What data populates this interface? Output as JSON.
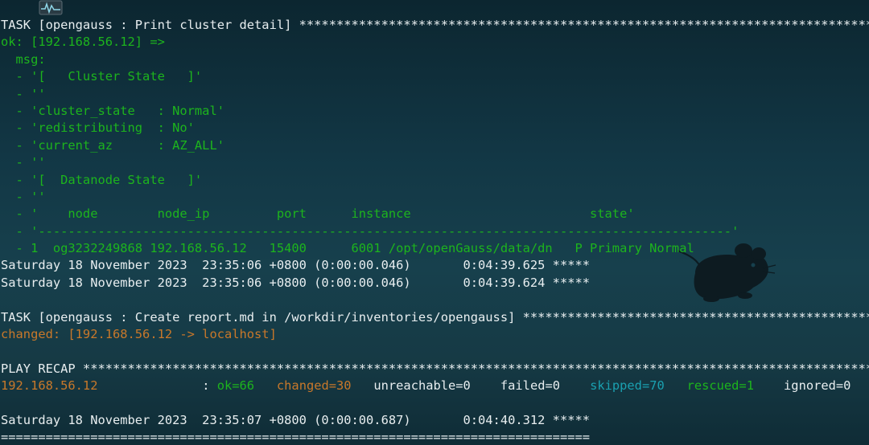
{
  "lines": [
    [
      {
        "t": "TASK [opengauss : Print cluster detail] **************************************************************************************************************",
        "c": "w"
      }
    ],
    [
      {
        "t": "ok: [192.168.56.12] =>",
        "c": "g"
      }
    ],
    [
      {
        "t": "  msg:",
        "c": "g"
      }
    ],
    [
      {
        "t": "  - '[   Cluster State   ]'",
        "c": "g"
      }
    ],
    [
      {
        "t": "  - ''",
        "c": "g"
      }
    ],
    [
      {
        "t": "  - 'cluster_state   : Normal'",
        "c": "g"
      }
    ],
    [
      {
        "t": "  - 'redistributing  : No'",
        "c": "g"
      }
    ],
    [
      {
        "t": "  - 'current_az      : AZ_ALL'",
        "c": "g"
      }
    ],
    [
      {
        "t": "  - ''",
        "c": "g"
      }
    ],
    [
      {
        "t": "  - '[  Datanode State   ]'",
        "c": "g"
      }
    ],
    [
      {
        "t": "  - ''",
        "c": "g"
      }
    ],
    [
      {
        "t": "  - '    node        node_ip         port      instance                        state'",
        "c": "g"
      }
    ],
    [
      {
        "t": "  - '---------------------------------------------------------------------------------------------'",
        "c": "g"
      }
    ],
    [
      {
        "t": "  - 1  og3232249868 192.168.56.12   15400      6001 /opt/openGauss/data/dn   P Primary Normal",
        "c": "g"
      }
    ],
    [
      {
        "t": "Saturday 18 November 2023  23:35:06 +0800 (0:00:00.046)       0:04:39.625 *****",
        "c": "w"
      }
    ],
    [
      {
        "t": "Saturday 18 November 2023  23:35:06 +0800 (0:00:00.046)       0:04:39.624 *****",
        "c": "w"
      }
    ],
    [
      {
        "t": "",
        "c": "w"
      }
    ],
    [
      {
        "t": "TASK [opengauss : Create report.md in /workdir/inventories/opengauss] ************************************************************************",
        "c": "w"
      }
    ],
    [
      {
        "t": "changed: [192.168.56.12 -> localhost]",
        "c": "o"
      }
    ],
    [
      {
        "t": "",
        "c": "w"
      }
    ],
    [
      {
        "t": "PLAY RECAP ***********************************************************************************************************************************",
        "c": "w"
      }
    ],
    [
      {
        "t": "192.168.56.12",
        "c": "o"
      },
      {
        "t": "              : ",
        "c": "w"
      },
      {
        "t": "ok=66",
        "c": "g"
      },
      {
        "t": "   ",
        "c": "w"
      },
      {
        "t": "changed=30",
        "c": "o"
      },
      {
        "t": "   unreachable=0    failed=0    ",
        "c": "w"
      },
      {
        "t": "skipped=70",
        "c": "c"
      },
      {
        "t": "   ",
        "c": "w"
      },
      {
        "t": "rescued=1",
        "c": "g"
      },
      {
        "t": "    ignored=0",
        "c": "w"
      }
    ],
    [
      {
        "t": "",
        "c": "w"
      }
    ],
    [
      {
        "t": "Saturday 18 November 2023  23:35:07 +0800 (0:00:00.687)       0:04:40.312 *****",
        "c": "w"
      }
    ],
    [
      {
        "t": "===============================================================================",
        "c": "w"
      }
    ]
  ],
  "colors": {
    "default": "#e8eef0",
    "ok": "#1db41d",
    "changed": "#c8782a",
    "skipped": "#1aa0b0",
    "background": "#17404d"
  },
  "icons": {
    "app": "activity-monitor-icon",
    "wallpaper": "xfce-mouse-logo-icon"
  }
}
